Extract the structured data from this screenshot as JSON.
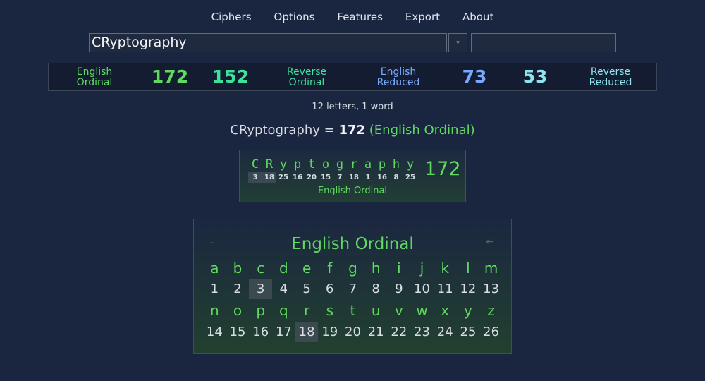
{
  "menu": [
    "Ciphers",
    "Options",
    "Features",
    "Export",
    "About"
  ],
  "phrase_input": {
    "value": "CRyptography"
  },
  "dropdown": {
    "icon": "▾"
  },
  "summary": {
    "english_ordinal": {
      "label_line1": "English",
      "label_line2": "Ordinal",
      "value": "172"
    },
    "full_reduction": {
      "value": "152"
    },
    "reverse_ordinal": {
      "label_line1": "Reverse",
      "label_line2": "Ordinal"
    },
    "english_reduced": {
      "label_line1": "English",
      "label_line2": "Reduced",
      "value": "73"
    },
    "reverse_reduced": {
      "label_line1": "Reverse",
      "label_line2": "Reduced",
      "value": "53"
    }
  },
  "count_text": "12 letters, 1 word",
  "result": {
    "phrase": "CRyptography",
    "equals": " = ",
    "value": "172",
    "cipher": "(English Ordinal)"
  },
  "breakdown": {
    "letters": [
      "C",
      "R",
      "y",
      "p",
      "t",
      "o",
      "g",
      "r",
      "a",
      "p",
      "h",
      "y"
    ],
    "values": [
      "3",
      "18",
      "25",
      "16",
      "20",
      "15",
      "7",
      "18",
      "1",
      "16",
      "8",
      "25"
    ],
    "highlighted": [
      0,
      1
    ],
    "total": "172",
    "cipher": "English Ordinal"
  },
  "chart": {
    "title": "English Ordinal",
    "minus_icon": "-",
    "arrow_icon": "←",
    "row1_letters": [
      "a",
      "b",
      "c",
      "d",
      "e",
      "f",
      "g",
      "h",
      "i",
      "j",
      "k",
      "l",
      "m"
    ],
    "row1_numbers": [
      "1",
      "2",
      "3",
      "4",
      "5",
      "6",
      "7",
      "8",
      "9",
      "10",
      "11",
      "12",
      "13"
    ],
    "row2_letters": [
      "n",
      "o",
      "p",
      "q",
      "r",
      "s",
      "t",
      "u",
      "v",
      "w",
      "x",
      "y",
      "z"
    ],
    "row2_numbers": [
      "14",
      "15",
      "16",
      "17",
      "18",
      "19",
      "20",
      "21",
      "22",
      "23",
      "24",
      "25",
      "26"
    ],
    "highlighted_numbers": [
      "3",
      "18"
    ]
  },
  "colors": {
    "background": "#1a2540",
    "green": "#5fd95f",
    "mint": "#3ee09a",
    "blue": "#79a8ff",
    "cyan": "#8fe3ee"
  }
}
